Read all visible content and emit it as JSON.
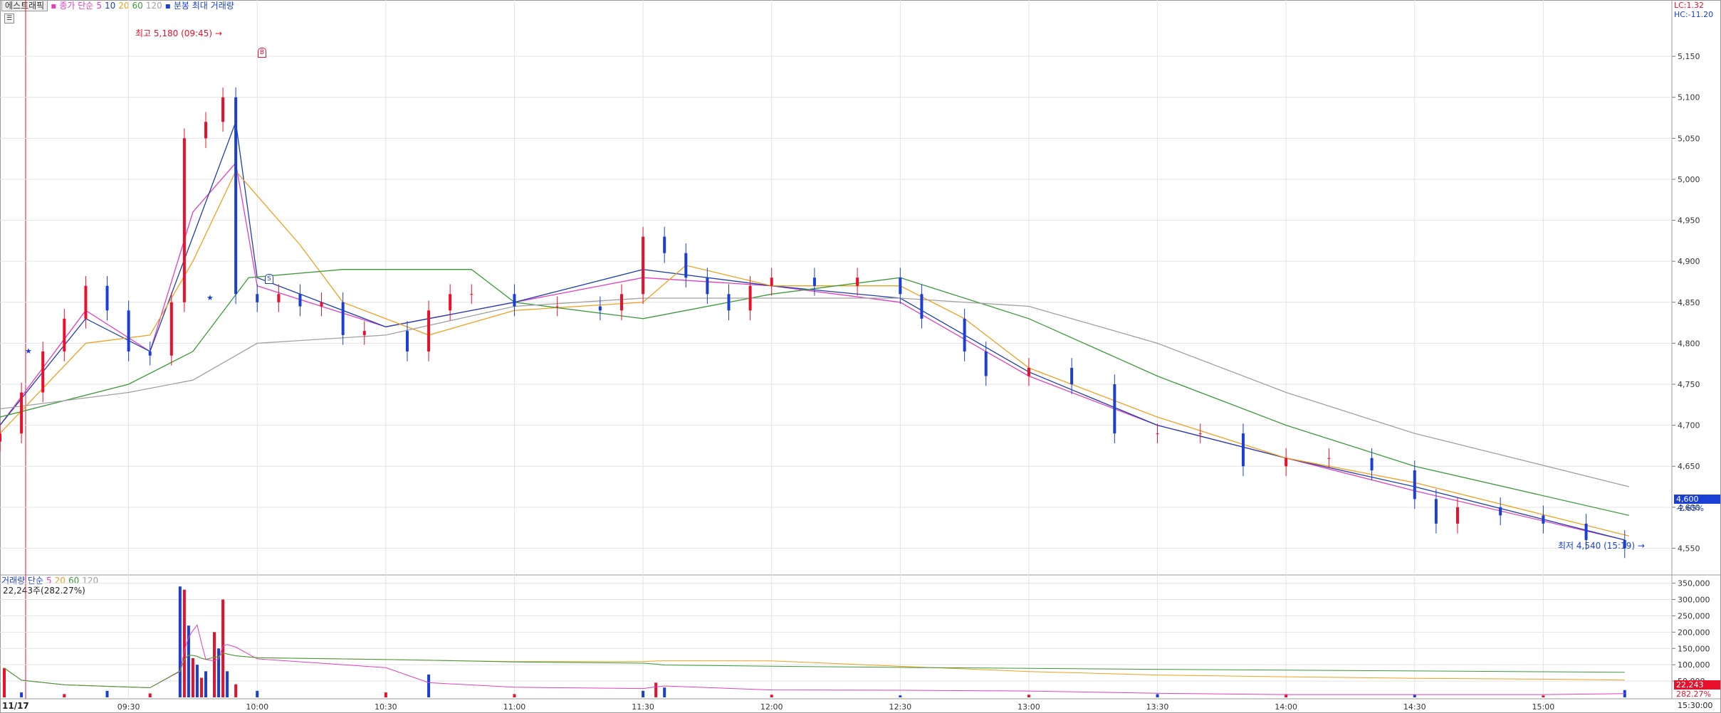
{
  "stock_name": "에스트래픽",
  "price_legend": {
    "prefix": "종가 단순",
    "ma5": "5",
    "ma10": "10",
    "ma20": "20",
    "ma60": "60",
    "ma120": "120",
    "extra": "분봉 최대 거래량"
  },
  "volume_legend": {
    "prefix": "거래량 단순",
    "ma5": "5",
    "ma20": "20",
    "ma60": "60",
    "ma120": "120",
    "current": "22,243주(282.27%)"
  },
  "lc_label": "LC:1.32",
  "hc_label": "HC:-11.20",
  "high_label": "최고 5,180 (09:45)",
  "low_label": "최저 4,540 (15:19)",
  "current_price_label": "4,600",
  "current_change_label": "-2.65%",
  "current_volume_label": "22,243",
  "current_volume_pct": "282.27%",
  "date_label": "11/17",
  "end_time_label": "15:30:00",
  "marker_s": "S",
  "marker_b": "B",
  "colors": {
    "up": "#e8102a",
    "down": "#1a3fd4",
    "ma5": "#e040c0",
    "ma10": "#1f3fb0",
    "ma20": "#f0a020",
    "ma60": "#3a9a3a",
    "ma120": "#a0a0a0",
    "grid": "#e3e3e3"
  },
  "chart_data": [
    {
      "type": "candlestick",
      "title": "",
      "x_axis": {
        "ticks": [
          "09:30",
          "10:00",
          "10:30",
          "11:00",
          "11:30",
          "12:00",
          "12:30",
          "13:00",
          "13:30",
          "14:00",
          "14:30",
          "15:00"
        ],
        "range": [
          "09:00",
          "15:30"
        ]
      },
      "y_axis": {
        "ticks": [
          4550,
          4600,
          4650,
          4700,
          4750,
          4800,
          4850,
          4900,
          4950,
          5000,
          5050,
          5100,
          5150
        ],
        "range": [
          4520,
          5210
        ]
      },
      "series": [
        {
          "name": "종가",
          "points": [
            [
              "09:00",
              4690
            ],
            [
              "09:05",
              4740
            ],
            [
              "09:10",
              4790
            ],
            [
              "09:15",
              4830
            ],
            [
              "09:20",
              4870
            ],
            [
              "09:25",
              4840
            ],
            [
              "09:30",
              4790
            ],
            [
              "09:35",
              4785
            ],
            [
              "09:40",
              4850
            ],
            [
              "09:43",
              5050
            ],
            [
              "09:48",
              5070
            ],
            [
              "09:52",
              5100
            ],
            [
              "09:55",
              4860
            ],
            [
              "10:00",
              4850
            ],
            [
              "10:05",
              4860
            ],
            [
              "10:10",
              4845
            ],
            [
              "10:15",
              4850
            ],
            [
              "10:20",
              4810
            ],
            [
              "10:25",
              4815
            ],
            [
              "10:35",
              4790
            ],
            [
              "10:40",
              4840
            ],
            [
              "10:45",
              4860
            ],
            [
              "10:50",
              4860
            ],
            [
              "11:00",
              4845
            ],
            [
              "11:10",
              4845
            ],
            [
              "11:20",
              4840
            ],
            [
              "11:25",
              4860
            ],
            [
              "11:30",
              4930
            ],
            [
              "11:35",
              4910
            ],
            [
              "11:40",
              4880
            ],
            [
              "11:45",
              4860
            ],
            [
              "11:50",
              4840
            ],
            [
              "11:55",
              4870
            ],
            [
              "12:00",
              4880
            ],
            [
              "12:10",
              4870
            ],
            [
              "12:20",
              4880
            ],
            [
              "12:30",
              4860
            ],
            [
              "12:35",
              4830
            ],
            [
              "12:45",
              4790
            ],
            [
              "12:50",
              4760
            ],
            [
              "13:00",
              4770
            ],
            [
              "13:10",
              4750
            ],
            [
              "13:20",
              4690
            ],
            [
              "13:30",
              4690
            ],
            [
              "13:40",
              4690
            ],
            [
              "13:50",
              4650
            ],
            [
              "14:00",
              4660
            ],
            [
              "14:10",
              4660
            ],
            [
              "14:20",
              4645
            ],
            [
              "14:30",
              4610
            ],
            [
              "14:35",
              4580
            ],
            [
              "14:40",
              4600
            ],
            [
              "14:50",
              4590
            ],
            [
              "15:00",
              4580
            ],
            [
              "15:10",
              4560
            ],
            [
              "15:19",
              4550
            ]
          ]
        },
        {
          "name": "5",
          "points": [
            [
              "09:00",
              4700
            ],
            [
              "09:20",
              4840
            ],
            [
              "09:35",
              4790
            ],
            [
              "09:45",
              4960
            ],
            [
              "09:55",
              5020
            ],
            [
              "10:00",
              4870
            ],
            [
              "10:30",
              4820
            ],
            [
              "11:00",
              4850
            ],
            [
              "11:30",
              4880
            ],
            [
              "12:00",
              4870
            ],
            [
              "12:30",
              4850
            ],
            [
              "13:00",
              4760
            ],
            [
              "13:30",
              4700
            ],
            [
              "14:00",
              4660
            ],
            [
              "14:30",
              4620
            ],
            [
              "15:19",
              4560
            ]
          ]
        },
        {
          "name": "10",
          "points": [
            [
              "09:00",
              4700
            ],
            [
              "09:20",
              4830
            ],
            [
              "09:35",
              4790
            ],
            [
              "09:45",
              4930
            ],
            [
              "09:55",
              5070
            ],
            [
              "10:00",
              4880
            ],
            [
              "10:30",
              4820
            ],
            [
              "11:00",
              4850
            ],
            [
              "11:30",
              4890
            ],
            [
              "12:00",
              4870
            ],
            [
              "12:30",
              4855
            ],
            [
              "13:00",
              4765
            ],
            [
              "13:30",
              4700
            ],
            [
              "14:00",
              4660
            ],
            [
              "14:30",
              4625
            ],
            [
              "15:19",
              4560
            ]
          ]
        },
        {
          "name": "20",
          "points": [
            [
              "09:00",
              4690
            ],
            [
              "09:20",
              4800
            ],
            [
              "09:35",
              4810
            ],
            [
              "09:45",
              4900
            ],
            [
              "09:55",
              5010
            ],
            [
              "10:10",
              4920
            ],
            [
              "10:20",
              4850
            ],
            [
              "10:40",
              4810
            ],
            [
              "11:00",
              4840
            ],
            [
              "11:30",
              4850
            ],
            [
              "11:40",
              4895
            ],
            [
              "12:00",
              4870
            ],
            [
              "12:30",
              4870
            ],
            [
              "12:45",
              4830
            ],
            [
              "13:00",
              4770
            ],
            [
              "13:30",
              4710
            ],
            [
              "14:00",
              4660
            ],
            [
              "14:30",
              4630
            ],
            [
              "15:20",
              4565
            ]
          ]
        },
        {
          "name": "60",
          "points": [
            [
              "09:00",
              4710
            ],
            [
              "09:30",
              4750
            ],
            [
              "09:45",
              4790
            ],
            [
              "09:58",
              4880
            ],
            [
              "10:20",
              4890
            ],
            [
              "10:50",
              4890
            ],
            [
              "11:00",
              4850
            ],
            [
              "11:30",
              4830
            ],
            [
              "12:00",
              4860
            ],
            [
              "12:30",
              4880
            ],
            [
              "13:00",
              4830
            ],
            [
              "13:30",
              4760
            ],
            [
              "14:00",
              4700
            ],
            [
              "14:30",
              4650
            ],
            [
              "15:20",
              4590
            ]
          ]
        },
        {
          "name": "120",
          "points": [
            [
              "09:00",
              4720
            ],
            [
              "09:30",
              4740
            ],
            [
              "09:45",
              4755
            ],
            [
              "10:00",
              4800
            ],
            [
              "10:30",
              4810
            ],
            [
              "11:00",
              4845
            ],
            [
              "11:30",
              4855
            ],
            [
              "12:00",
              4855
            ],
            [
              "12:30",
              4855
            ],
            [
              "13:00",
              4845
            ],
            [
              "13:30",
              4800
            ],
            [
              "14:00",
              4740
            ],
            [
              "14:30",
              4690
            ],
            [
              "15:20",
              4625
            ]
          ]
        }
      ],
      "annotations": {
        "high": 5180,
        "low": 4540,
        "current": 4600
      }
    },
    {
      "type": "bar",
      "title": "",
      "x_axis": {
        "range": [
          "09:00",
          "15:30"
        ]
      },
      "y_axis": {
        "ticks": [
          50000,
          100000,
          150000,
          200000,
          250000,
          300000,
          350000
        ],
        "range": [
          0,
          360000
        ]
      },
      "series": [
        {
          "name": "거래량",
          "points": [
            [
              "09:01",
              90000
            ],
            [
              "09:05",
              15000
            ],
            [
              "09:15",
              10000
            ],
            [
              "09:25",
              20000
            ],
            [
              "09:35",
              12000
            ],
            [
              "09:42",
              340000
            ],
            [
              "09:43",
              330000
            ],
            [
              "09:44",
              220000
            ],
            [
              "09:45",
              120000
            ],
            [
              "09:46",
              100000
            ],
            [
              "09:47",
              60000
            ],
            [
              "09:48",
              80000
            ],
            [
              "09:50",
              200000
            ],
            [
              "09:51",
              150000
            ],
            [
              "09:52",
              300000
            ],
            [
              "09:53",
              80000
            ],
            [
              "09:55",
              40000
            ],
            [
              "10:00",
              20000
            ],
            [
              "10:30",
              15000
            ],
            [
              "10:40",
              70000
            ],
            [
              "11:00",
              10000
            ],
            [
              "11:30",
              20000
            ],
            [
              "11:33",
              45000
            ],
            [
              "11:35",
              30000
            ],
            [
              "12:00",
              8000
            ],
            [
              "12:30",
              6000
            ],
            [
              "13:00",
              8000
            ],
            [
              "13:30",
              10000
            ],
            [
              "14:00",
              10000
            ],
            [
              "14:30",
              8000
            ],
            [
              "15:00",
              6000
            ],
            [
              "15:19",
              22243
            ]
          ]
        }
      ]
    }
  ]
}
